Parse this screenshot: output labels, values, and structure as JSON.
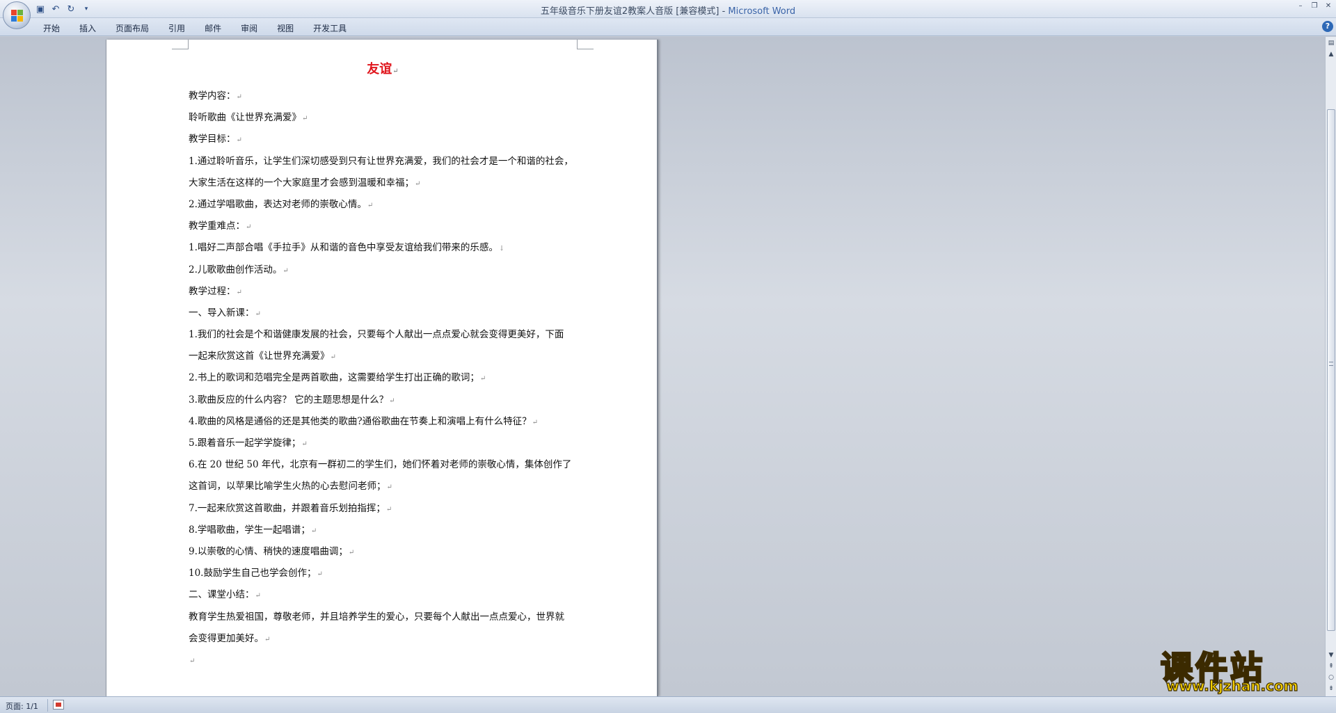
{
  "window": {
    "title_doc": "五年级音乐下册友谊2教案人音版 [兼容模式]",
    "title_sep": " - ",
    "title_app": "Microsoft Word"
  },
  "quick_access": {
    "icons": [
      "save-icon",
      "undo-icon",
      "redo-icon",
      "customize-qat-icon"
    ]
  },
  "ribbon": {
    "tabs": [
      "开始",
      "插入",
      "页面布局",
      "引用",
      "邮件",
      "审阅",
      "视图",
      "开发工具"
    ]
  },
  "document": {
    "title": "友谊",
    "paragraph_mark": "↵",
    "manual_break_mark": "↓",
    "lines": [
      "教学内容：",
      "聆听歌曲《让世界充满爱》",
      "教学目标：",
      "1.通过聆听音乐，让学生们深切感受到只有让世界充满爱，我们的社会才是一个和谐的社会，",
      "大家生活在这样的一个大家庭里才会感到温暖和幸福；",
      "2.通过学唱歌曲，表达对老师的崇敬心情。",
      "教学重难点：",
      "1.唱好二声部合唱《手拉手》从和谐的音色中享受友谊给我们带来的乐感。",
      "2.儿歌歌曲创作活动。",
      "教学过程：",
      "一、导入新课：",
      "1.我们的社会是个和谐健康发展的社会，只要每个人献出一点点爱心就会变得更美好，下面",
      "一起来欣赏这首《让世界充满爱》",
      "2.书上的歌词和范唱完全是两首歌曲，这需要给学生打出正确的歌词；",
      "3.歌曲反应的什么内容？  它的主题思想是什么？",
      "4.歌曲的风格是通俗的还是其他类的歌曲?通俗歌曲在节奏上和演唱上有什么特征？",
      "5.跟着音乐一起学学旋律；",
      "6.在 20 世纪 50 年代，北京有一群初二的学生们，她们怀着对老师的崇敬心情，集体创作了",
      "这首词，以苹果比喻学生火热的心去慰问老师；",
      "7.一起来欣赏这首歌曲，并跟着音乐划拍指挥；",
      "8.学唱歌曲，学生一起唱谱；",
      "9.以崇敬的心情、稍快的速度唱曲调；",
      "10.鼓励学生自己也学会创作；",
      "二、课堂小结：",
      "教育学生热爱祖国，尊敬老师，并且培养学生的爱心，只要每个人献出一点点爱心，世界就",
      "会变得更加美好。",
      ""
    ]
  },
  "status_bar": {
    "page": "页面: 1/1"
  },
  "watermark": {
    "main": "课件站",
    "url": "www.kjzhan.com"
  }
}
